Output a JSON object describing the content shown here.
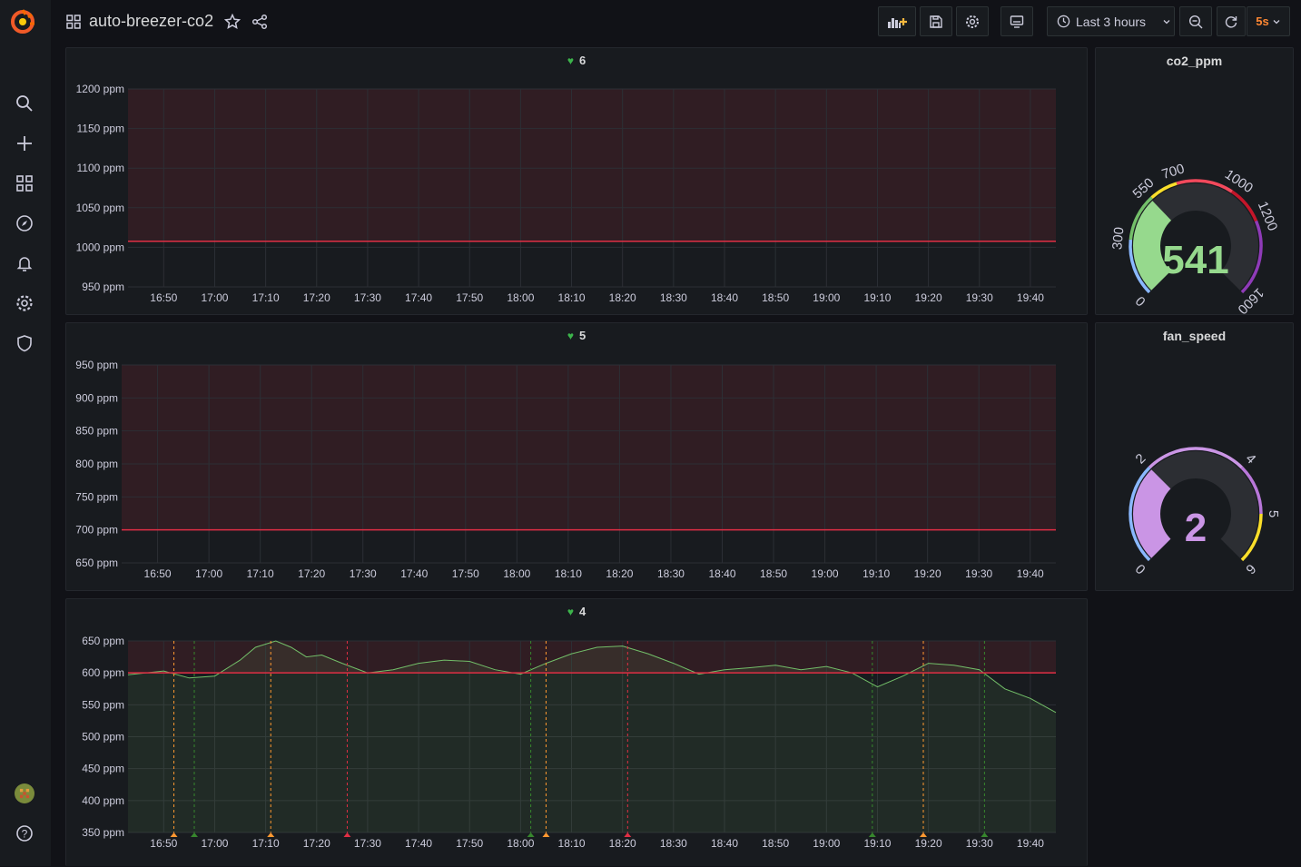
{
  "dashboard": {
    "title": "auto-breezer-co2"
  },
  "toolbar": {
    "time_range": "Last 3 hours",
    "refresh_interval": "5s"
  },
  "x_ticks": [
    "16:50",
    "17:00",
    "17:10",
    "17:20",
    "17:30",
    "17:40",
    "17:50",
    "18:00",
    "18:10",
    "18:20",
    "18:30",
    "18:40",
    "18:50",
    "19:00",
    "19:10",
    "19:20",
    "19:30",
    "19:40"
  ],
  "panels": {
    "graph1": {
      "title": "6",
      "state": "ok",
      "chart_data": {
        "type": "line",
        "y_ticks": [
          "1200 ppm",
          "1150 ppm",
          "1100 ppm",
          "1050 ppm",
          "1000 ppm",
          "950 ppm"
        ],
        "ylim": [
          940,
          1200
        ],
        "threshold": 1000,
        "threshold_color": "#e02f44"
      }
    },
    "graph2": {
      "title": "5",
      "state": "ok",
      "chart_data": {
        "type": "line",
        "y_ticks": [
          "950 ppm",
          "900 ppm",
          "850 ppm",
          "800 ppm",
          "750 ppm",
          "700 ppm",
          "650 ppm"
        ],
        "ylim": [
          650,
          950
        ],
        "threshold": 700,
        "threshold_color": "#e02f44"
      }
    },
    "graph3": {
      "title": "4",
      "state": "ok",
      "chart_data": {
        "type": "area",
        "y_ticks": [
          "650 ppm",
          "600 ppm",
          "550 ppm",
          "500 ppm",
          "450 ppm",
          "400 ppm",
          "350 ppm"
        ],
        "ylim": [
          350,
          650
        ],
        "threshold": 600,
        "threshold_color": "#e02f44",
        "series": [
          {
            "x": [
              "16:43",
              "16:50",
              "16:55",
              "17:00",
              "17:05",
              "17:08",
              "17:12",
              "17:15",
              "17:18",
              "17:21",
              "17:25",
              "17:30",
              "17:35",
              "17:40",
              "17:45",
              "17:50",
              "17:55",
              "18:00",
              "18:05",
              "18:10",
              "18:15",
              "18:20",
              "18:25",
              "18:30",
              "18:35",
              "18:40",
              "18:45",
              "18:50",
              "18:55",
              "19:00",
              "19:05",
              "19:10",
              "19:15",
              "19:20",
              "19:25",
              "19:30",
              "19:35",
              "19:40",
              "19:45"
            ],
            "y": [
              597,
              603,
              592,
              595,
              620,
              640,
              650,
              640,
              625,
              628,
              615,
              600,
              605,
              615,
              620,
              618,
              605,
              598,
              615,
              630,
              640,
              642,
              630,
              615,
              598,
              605,
              608,
              612,
              605,
              610,
              600,
              578,
              595,
              615,
              612,
              605,
              575,
              560,
              538
            ]
          }
        ],
        "annotations": [
          {
            "time": "16:52",
            "color": "#ff9830"
          },
          {
            "time": "16:56",
            "color": "#37872d"
          },
          {
            "time": "17:11",
            "color": "#ff9830"
          },
          {
            "time": "17:26",
            "color": "#e02f44"
          },
          {
            "time": "18:02",
            "color": "#37872d"
          },
          {
            "time": "18:05",
            "color": "#ff9830"
          },
          {
            "time": "18:21",
            "color": "#e02f44"
          },
          {
            "time": "19:09",
            "color": "#37872d"
          },
          {
            "time": "19:19",
            "color": "#ff9830"
          },
          {
            "time": "19:31",
            "color": "#37872d"
          }
        ]
      }
    }
  },
  "gauges": {
    "co2": {
      "title": "co2_ppm",
      "value": 541,
      "min": 0,
      "max": 1600,
      "ticks": [
        "0",
        "300",
        "550",
        "700",
        "1000",
        "1200",
        "1600"
      ],
      "value_color": "#96d98d"
    },
    "fan": {
      "title": "fan_speed",
      "value": 2,
      "min": 0,
      "max": 6,
      "ticks": [
        "0",
        "2",
        "4",
        "5",
        "6"
      ],
      "value_color": "#ca95e5"
    }
  }
}
